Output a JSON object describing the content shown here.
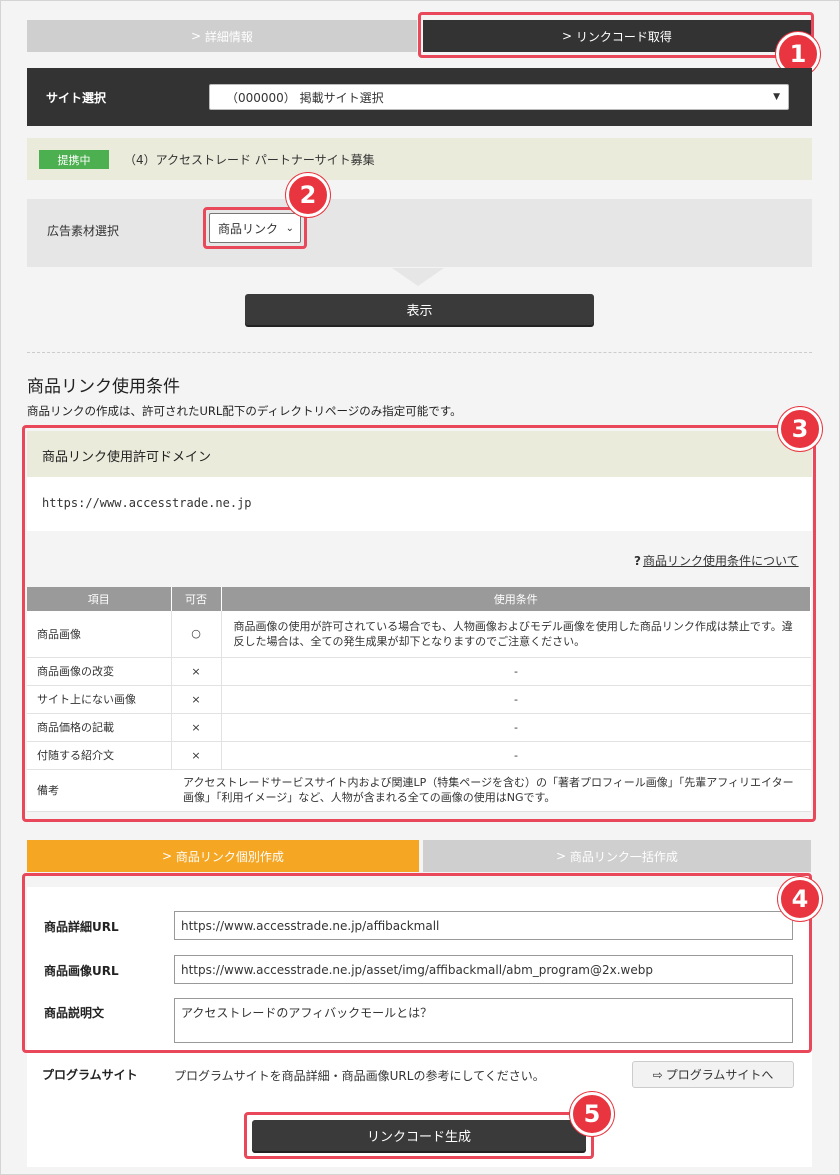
{
  "tabs": {
    "detail": "詳細情報",
    "linkcode": "リンクコード取得"
  },
  "site": {
    "label": "サイト選択",
    "selected": "（000000） 掲載サイト選択"
  },
  "program": {
    "badge": "提携中",
    "name": "（4）アクセストレード パートナーサイト募集"
  },
  "material": {
    "label": "広告素材選択",
    "selected": "商品リンク"
  },
  "display_button": "表示",
  "conditions": {
    "heading": "商品リンク使用条件",
    "note": "商品リンクの作成は、許可されたURL配下のディレクトリページのみ指定可能です。",
    "domain_title": "商品リンク使用許可ドメイン",
    "domain": "https://www.accesstrade.ne.jp",
    "help_link": "商品リンク使用条件について",
    "help_mark": "?",
    "table": {
      "headers": [
        "項目",
        "可否",
        "使用条件"
      ],
      "rows": [
        {
          "item": "商品画像",
          "ok": "○",
          "cond": "商品画像の使用が許可されている場合でも、人物画像およびモデル画像を使用した商品リンク作成は禁止です。違反した場合は、全ての発生成果が却下となりますのでご注意ください。"
        },
        {
          "item": "商品画像の改変",
          "ok": "×",
          "cond": "-"
        },
        {
          "item": "サイト上にない画像",
          "ok": "×",
          "cond": "-"
        },
        {
          "item": "商品価格の記載",
          "ok": "×",
          "cond": "-"
        },
        {
          "item": "付随する紹介文",
          "ok": "×",
          "cond": "-"
        }
      ],
      "remarks_label": "備考",
      "remarks": "アクセストレードサービスサイト内および関連LP（特集ページを含む）の「著者プロフィール画像」「先輩アフィリエイター画像」「利用イメージ」など、人物が含まれる全ての画像の使用はNGです。"
    }
  },
  "create_tabs": {
    "single": "商品リンク個別作成",
    "bulk": "商品リンク一括作成"
  },
  "form": {
    "detail_url_label": "商品詳細URL",
    "detail_url": "https://www.accesstrade.ne.jp/affibackmall",
    "image_url_label": "商品画像URL",
    "image_url": "https://www.accesstrade.ne.jp/asset/img/affibackmall/abm_program@2x.webp",
    "desc_label": "商品説明文",
    "desc": "アクセストレードのアフィバックモールとは？",
    "program_site_label": "プログラムサイト",
    "program_site_note": "プログラムサイトを商品詳細・商品画像URLの参考にしてください。",
    "program_site_button": "プログラムサイトへ"
  },
  "generate_button": "リンクコード生成",
  "callouts": [
    "1",
    "2",
    "3",
    "4",
    "5"
  ],
  "colors": {
    "accent_red": "#e8485a",
    "tab_orange": "#f5a623",
    "badge_green": "#4caf50",
    "dark": "#333333"
  }
}
